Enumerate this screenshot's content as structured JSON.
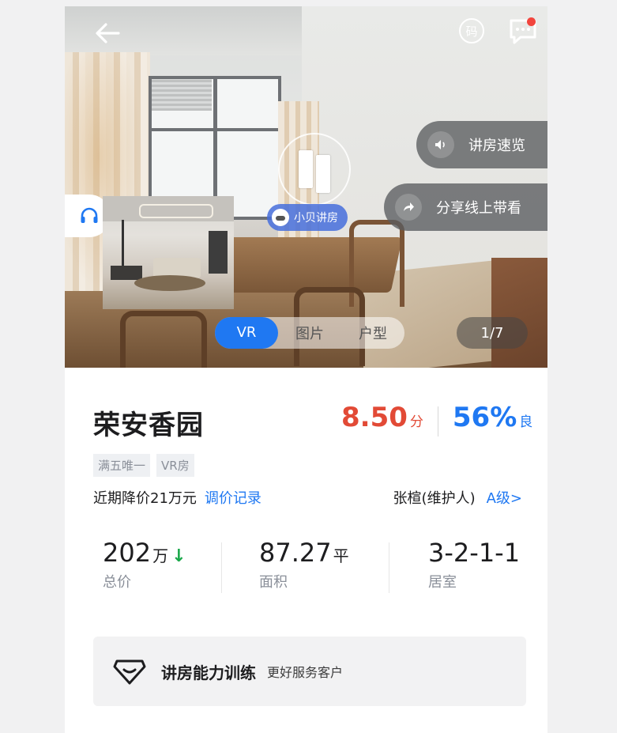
{
  "hero": {
    "photo_counter": "1/7",
    "tabs": [
      {
        "label": "VR",
        "active": true
      },
      {
        "label": "图片",
        "active": false
      },
      {
        "label": "户型",
        "active": false
      }
    ],
    "overlay_buttons": {
      "quick_tour": "讲房速览",
      "share_online_viewing": "分享线上带看"
    },
    "agent_chip": "小贝讲房",
    "qr_glyph": "码",
    "icons": [
      "back-arrow-icon",
      "qr-code-icon",
      "message-icon",
      "speaker-icon",
      "share-arrow-icon",
      "headset-icon"
    ]
  },
  "listing": {
    "title": "荣安香园",
    "score_value": "8.50",
    "score_unit": "分",
    "good_rate": "56%",
    "good_rate_unit": "良",
    "tags": [
      "满五唯一",
      "VR房"
    ],
    "price_cut_text": "近期降价21万元",
    "price_history_link": "调价记录",
    "maintainer": "张楦(维护人)",
    "maintainer_level": "A级>"
  },
  "stats": [
    {
      "value": "202",
      "unit": "万",
      "label": "总价",
      "trend": "down"
    },
    {
      "value": "87.27",
      "unit": "平",
      "label": "面积"
    },
    {
      "value": "3-2-1-1",
      "unit": "",
      "label": "居室"
    }
  ],
  "training": {
    "title": "讲房能力训练",
    "subtitle": "更好服务客户"
  },
  "colors": {
    "accent_blue": "#1f78f2",
    "score_red": "#e24a36",
    "trend_green": "#1aa84a",
    "notification_dot": "#f2453d"
  }
}
